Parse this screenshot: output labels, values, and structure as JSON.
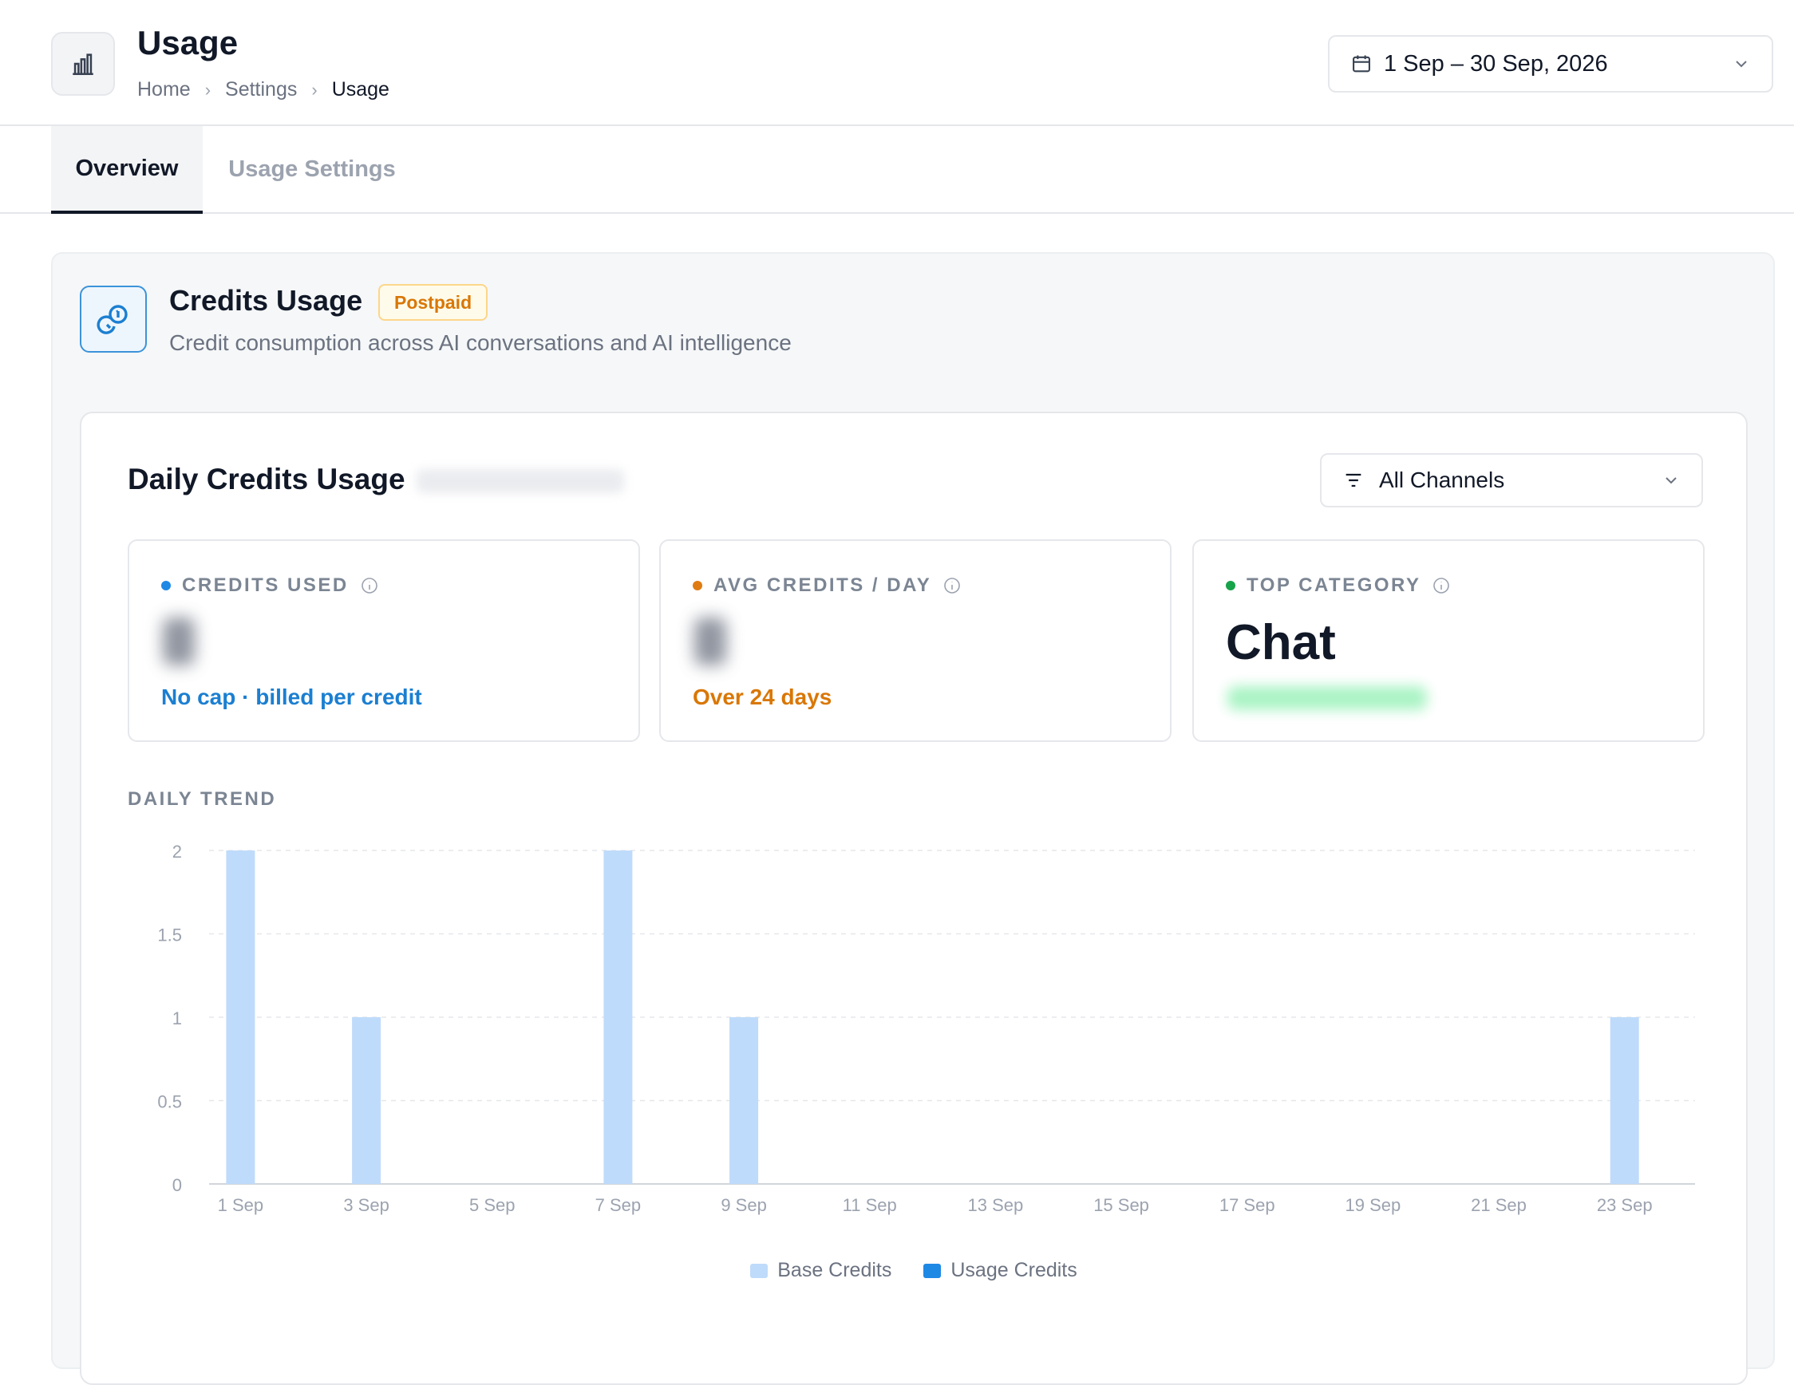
{
  "header": {
    "title": "Usage",
    "breadcrumb": [
      "Home",
      "Settings",
      "Usage"
    ],
    "date_range": "1 Sep – 30 Sep, 2026"
  },
  "tabs": [
    {
      "label": "Overview",
      "active": true
    },
    {
      "label": "Usage Settings",
      "active": false
    }
  ],
  "credits": {
    "title": "Credits Usage",
    "badge": "Postpaid",
    "subtitle": "Credit consumption across AI conversations and AI intelligence"
  },
  "daily": {
    "title": "Daily Credits Usage",
    "channel_filter": "All Channels",
    "stats": [
      {
        "label": "CREDITS USED",
        "note": "No cap · billed per credit",
        "dot_color": "#1e88e5",
        "note_color": "#1b7fd1"
      },
      {
        "label": "AVG CREDITS / DAY",
        "note": "Over 24 days",
        "dot_color": "#e07b12",
        "note_color": "#d97706"
      },
      {
        "label": "TOP CATEGORY",
        "value": "Chat",
        "dot_color": "#16a34a"
      }
    ],
    "trend_label": "DAILY TREND"
  },
  "chart_data": {
    "type": "bar",
    "categories": [
      "1 Sep",
      "2 Sep",
      "3 Sep",
      "4 Sep",
      "5 Sep",
      "6 Sep",
      "7 Sep",
      "8 Sep",
      "9 Sep",
      "10 Sep",
      "11 Sep",
      "12 Sep",
      "13 Sep",
      "14 Sep",
      "15 Sep",
      "16 Sep",
      "17 Sep",
      "18 Sep",
      "19 Sep",
      "20 Sep",
      "21 Sep",
      "22 Sep",
      "23 Sep",
      "24 Sep"
    ],
    "x_tick_labels": [
      "1 Sep",
      "3 Sep",
      "5 Sep",
      "7 Sep",
      "9 Sep",
      "11 Sep",
      "13 Sep",
      "15 Sep",
      "17 Sep",
      "19 Sep",
      "21 Sep",
      "23 Sep"
    ],
    "y_ticks": [
      "0",
      "0.5",
      "1",
      "1.5",
      "2"
    ],
    "ylim": [
      0,
      2
    ],
    "stacked": true,
    "grid": true,
    "legend_position": "bottom-center",
    "series": [
      {
        "name": "Base Credits",
        "color": "#bfdbfb",
        "values": [
          2,
          0,
          1,
          0,
          0,
          0,
          2,
          0,
          1,
          0,
          0,
          0,
          0,
          0,
          0,
          0,
          0,
          0,
          0,
          0,
          0,
          0,
          1,
          0
        ]
      },
      {
        "name": "Usage Credits",
        "color": "#1e88e5",
        "values": [
          0,
          0,
          0,
          0,
          0,
          0,
          0,
          0,
          0,
          0,
          0,
          0,
          0,
          0,
          0,
          0,
          0,
          0,
          0,
          0,
          0,
          0,
          0,
          0
        ]
      }
    ]
  }
}
